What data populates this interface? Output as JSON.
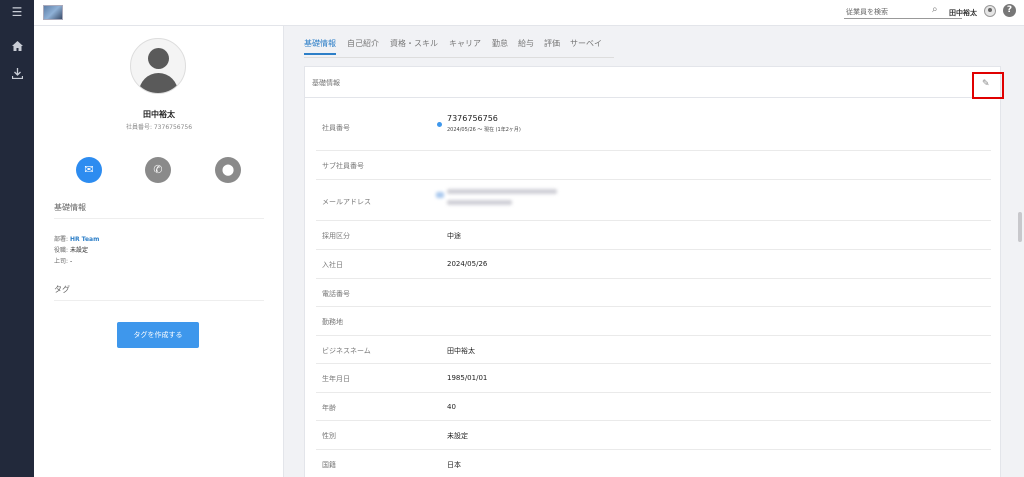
{
  "header": {
    "search_placeholder": "従業員を検索",
    "user_name": "田中裕太",
    "help_label": "?"
  },
  "rail": {
    "menu_icon": "menu-icon",
    "home_icon": "home-icon",
    "download_icon": "download-icon"
  },
  "profile": {
    "name": "田中裕太",
    "employee_id_label": "社員番号: 7376756756",
    "section_basic": "基礎情報",
    "department_label": "部署: ",
    "department_value": "HR Team",
    "position_label": "役職: ",
    "position_value": "未設定",
    "boss_label": "上司: ",
    "boss_value": "-",
    "section_tag": "タグ",
    "create_tag_button": "タグを作成する"
  },
  "tabs": [
    "基礎情報",
    "自己紹介",
    "資格・スキル",
    "キャリア",
    "勤怠",
    "給与",
    "評価",
    "サーベイ"
  ],
  "card": {
    "title": "基礎情報",
    "rows": [
      {
        "label": "社員番号",
        "value": "7376756756",
        "sub": "2024/05/26 〜 現在 (1年2ヶ月)"
      },
      {
        "label": "サブ社員番号",
        "value": ""
      },
      {
        "label": "メールアドレス",
        "value": ""
      },
      {
        "label": "採用区分",
        "value": "中途"
      },
      {
        "label": "入社日",
        "value": "2024/05/26"
      },
      {
        "label": "電話番号",
        "value": ""
      },
      {
        "label": "勤務地",
        "value": ""
      },
      {
        "label": "ビジネスネーム",
        "value": "田中裕太"
      },
      {
        "label": "生年月日",
        "value": "1985/01/01"
      },
      {
        "label": "年齢",
        "value": "40"
      },
      {
        "label": "性別",
        "value": "未設定"
      },
      {
        "label": "国籍",
        "value": "日本"
      }
    ]
  },
  "colors": {
    "accent": "#2d7fc8",
    "button": "#3e97ec",
    "rail": "#22293b",
    "highlight": "#e00000"
  }
}
